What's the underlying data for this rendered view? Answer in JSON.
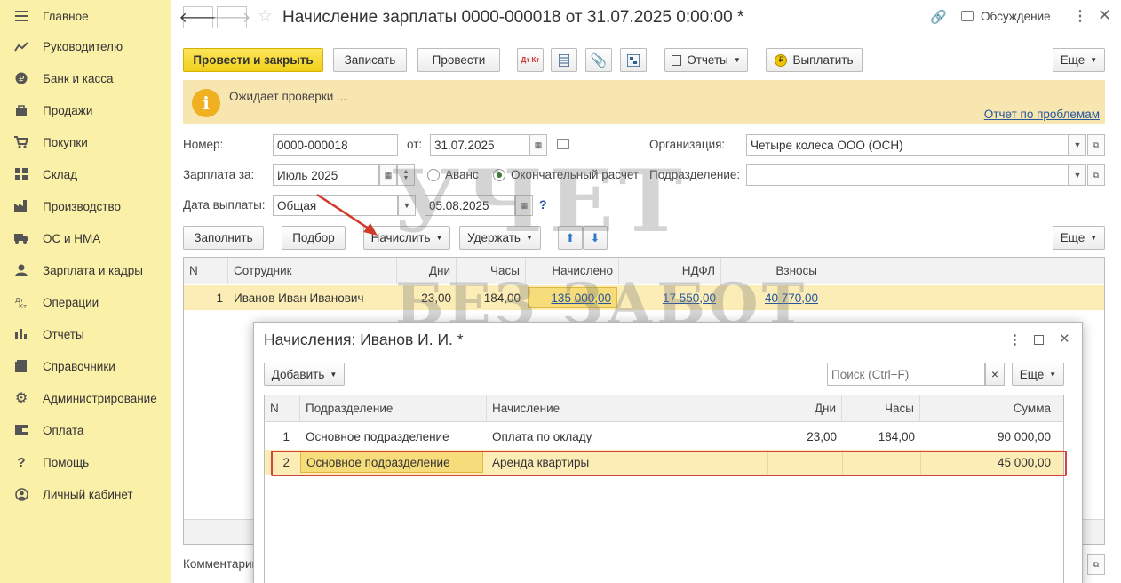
{
  "sidebar": {
    "items": [
      {
        "label": "Главное",
        "icon": "menu-icon"
      },
      {
        "label": "Руководителю",
        "icon": "chart-line-icon"
      },
      {
        "label": "Банк и касса",
        "icon": "coin-icon"
      },
      {
        "label": "Продажи",
        "icon": "bag-icon"
      },
      {
        "label": "Покупки",
        "icon": "cart-icon"
      },
      {
        "label": "Склад",
        "icon": "warehouse-icon"
      },
      {
        "label": "Производство",
        "icon": "factory-icon"
      },
      {
        "label": "ОС и НМА",
        "icon": "truck-icon"
      },
      {
        "label": "Зарплата и кадры",
        "icon": "person-icon"
      },
      {
        "label": "Операции",
        "icon": "dt-kt-icon"
      },
      {
        "label": "Отчеты",
        "icon": "bar-chart-icon"
      },
      {
        "label": "Справочники",
        "icon": "book-icon"
      },
      {
        "label": "Администрирование",
        "icon": "gear-icon"
      },
      {
        "label": "Оплата",
        "icon": "wallet-icon"
      },
      {
        "label": "Помощь",
        "icon": "question-icon"
      },
      {
        "label": "Личный кабинет",
        "icon": "user-circle-icon"
      }
    ]
  },
  "header": {
    "title": "Начисление зарплаты 0000-000018 от 31.07.2025 0:00:00 *",
    "discussion": "Обсуждение"
  },
  "toolbar": {
    "post_close": "Провести и закрыть",
    "save": "Записать",
    "post": "Провести",
    "dtkt": "Дт Кт",
    "reports": "Отчеты",
    "pay": "Выплатить",
    "more": "Еще"
  },
  "warning": {
    "text": "Ожидает проверки ...",
    "link": "Отчет по проблемам"
  },
  "form": {
    "number_label": "Номер:",
    "number": "0000-000018",
    "from_label": "от:",
    "date": "31.07.2025",
    "org_label": "Организация:",
    "org": "Четыре колеса ООО (ОСН)",
    "salary_label": "Зарплата за:",
    "salary_month": "Июль 2025",
    "advance": "Аванс",
    "final": "Окончательный расчет",
    "division_label": "Подразделение:",
    "division": "",
    "paydate_label": "Дата выплаты:",
    "paydate_type": "Общая",
    "paydate": "05.08.2025",
    "help": "?",
    "comment_label": "Комментарий"
  },
  "actions": {
    "fill": "Заполнить",
    "select": "Подбор",
    "accrue": "Начислить",
    "withhold": "Удержать",
    "more": "Еще"
  },
  "main_table": {
    "headers": [
      "N",
      "Сотрудник",
      "Дни",
      "Часы",
      "Начислено",
      "НДФЛ",
      "Взносы"
    ],
    "rows": [
      {
        "n": "1",
        "employee": "Иванов Иван Иванович",
        "days": "23,00",
        "hours": "184,00",
        "accrued": "135 000,00",
        "ndfl": "17 550,00",
        "contrib": "40 770,00"
      }
    ]
  },
  "modal": {
    "title": "Начисления: Иванов И. И. *",
    "add": "Добавить",
    "search_placeholder": "Поиск (Ctrl+F)",
    "clear": "×",
    "more": "Еще",
    "headers": [
      "N",
      "Подразделение",
      "Начисление",
      "Дни",
      "Часы",
      "Сумма"
    ],
    "rows": [
      {
        "n": "1",
        "division": "Основное подразделение",
        "accrual": "Оплата по окладу",
        "days": "23,00",
        "hours": "184,00",
        "sum": "90 000,00"
      },
      {
        "n": "2",
        "division": "Основное подразделение",
        "accrual": "Аренда квартиры",
        "days": "",
        "hours": "",
        "sum": "45 000,00"
      }
    ]
  },
  "watermark": {
    "line1": "УЧЕТ",
    "line2": "БЕЗ ЗАБОТ"
  }
}
